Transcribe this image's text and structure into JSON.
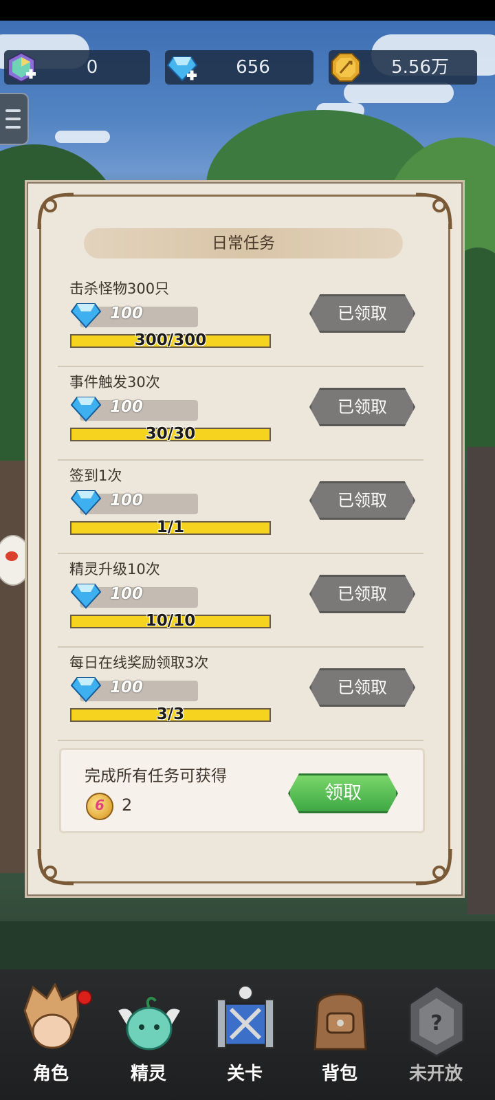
{
  "currencies": [
    {
      "name": "crystal",
      "icon": "rainbow-crystal-icon",
      "value": "0"
    },
    {
      "name": "diamond",
      "icon": "diamond-plus-icon",
      "value": "656"
    },
    {
      "name": "gold",
      "icon": "gold-coin-icon",
      "value": "5.56万"
    }
  ],
  "panel": {
    "title": "日常任务",
    "tasks": [
      {
        "name": "击杀怪物300只",
        "reward": "100",
        "progress": "300/300",
        "fraction": 1.0,
        "button": "已领取"
      },
      {
        "name": "事件触发30次",
        "reward": "100",
        "progress": "30/30",
        "fraction": 1.0,
        "button": "已领取"
      },
      {
        "name": "签到1次",
        "reward": "100",
        "progress": "1/1",
        "fraction": 1.0,
        "button": "已领取"
      },
      {
        "name": "精灵升级10次",
        "reward": "100",
        "progress": "10/10",
        "fraction": 1.0,
        "button": "已领取"
      },
      {
        "name": "每日在线奖励领取3次",
        "reward": "100",
        "progress": "3/3",
        "fraction": 1.0,
        "button": "已领取"
      }
    ],
    "bonus": {
      "label": "完成所有任务可获得",
      "count": "2",
      "button": "领取"
    }
  },
  "nav": [
    {
      "label": "角色",
      "icon": "character-icon",
      "badge": true
    },
    {
      "label": "精灵",
      "icon": "spirit-icon",
      "badge": false
    },
    {
      "label": "关卡",
      "icon": "stage-icon",
      "badge": false
    },
    {
      "label": "背包",
      "icon": "backpack-icon",
      "badge": false
    },
    {
      "label": "未开放",
      "icon": "locked-icon",
      "badge": false
    }
  ],
  "colors": {
    "progress": "#f5d31f",
    "claimed_button": "#7b7978",
    "claim_button": "#3fa843",
    "panel": "#ede6da"
  }
}
